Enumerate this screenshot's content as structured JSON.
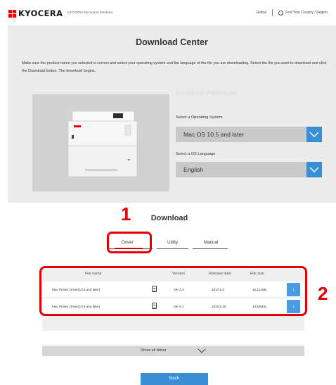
{
  "header": {
    "logo_text": "KYOCERA",
    "logo_sub": "KYOCERA Document Solutions",
    "global_label": "Global",
    "region_label": "Find Your Country / Region"
  },
  "download_center": {
    "title": "Download Center",
    "intro": "Make sure the product name you selected is correct and select your operating system and the language of the file you are downloading. Select the file you want to download and click the Download button. The download begins.",
    "model_name": "ECOSYS P4021cdn",
    "os_label": "Select a Operating System",
    "os_value": "Mac OS 10.5 and later",
    "lang_label": "Select a OS Language",
    "lang_value": "English"
  },
  "downloads": {
    "title": "Download",
    "tabs": [
      {
        "label": "Driver",
        "active": true
      },
      {
        "label": "Utility",
        "active": false
      },
      {
        "label": "Manual",
        "active": false
      }
    ],
    "columns": [
      "File name",
      "Version",
      "Release date",
      "File size"
    ],
    "rows": [
      {
        "name": "Mac Printer Driver(10.5 and later)",
        "version": "Ver 3.3",
        "date": "2017.8.2",
        "size": "15,114KB"
      },
      {
        "name": "Mac Printer Driver(10.9 and later)",
        "version": "Ver 5.1",
        "date": "2020.8.20",
        "size": "13,835KB"
      }
    ],
    "show_all": "Show all driver",
    "back": "Back"
  },
  "markers": {
    "one": "1",
    "two": "2"
  },
  "colors": {
    "accent_blue": "#3a8fd4",
    "highlight_red": "#e20000",
    "brand_red": "#e60012"
  },
  "icons": {
    "download": "download-arrow-icon",
    "chevron": "chevron-down-icon",
    "document": "document-icon",
    "globe": "globe-icon"
  }
}
